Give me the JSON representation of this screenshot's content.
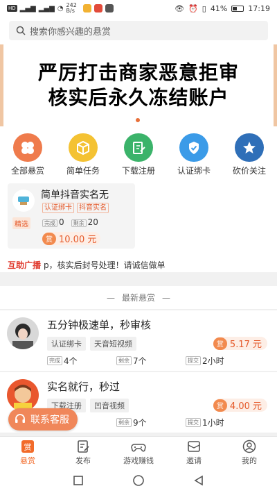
{
  "status_bar": {
    "network": "HD",
    "speed": "242 B/s",
    "battery": "41%",
    "time": "17:19"
  },
  "search": {
    "placeholder": "搜索你感兴趣的悬赏"
  },
  "banner": {
    "line1": "严厉打击商家恶意拒审",
    "line2": "核实后永久冻结账户"
  },
  "categories": [
    {
      "label": "全部悬赏",
      "icon": "clover-icon",
      "color": "#ef7b4c"
    },
    {
      "label": "简单任务",
      "icon": "box-icon",
      "color": "#f4c233"
    },
    {
      "label": "下载注册",
      "icon": "edit-doc-icon",
      "color": "#3bb36a"
    },
    {
      "label": "认证绑卡",
      "icon": "verified-icon",
      "color": "#3b9be8"
    },
    {
      "label": "砍价关注",
      "icon": "star-icon",
      "color": "#2f6fb8"
    }
  ],
  "featured": {
    "badge": "精选",
    "title": "简单抖音实名无",
    "tags": [
      "认证绑卡",
      "抖音实名"
    ],
    "done_label": "完成",
    "done_value": "0",
    "remain_label": "剩余",
    "remain_value": "20",
    "price_icon": "赏",
    "price": "10.00 元"
  },
  "broadcast": {
    "label": "互助广播",
    "text": "p，核实后封号处理！请诚信做单"
  },
  "latest": {
    "title": "最新悬赏"
  },
  "tasks": [
    {
      "title": "五分钟极速单，秒审核",
      "tags": [
        "认证绑卡",
        "天音短视频"
      ],
      "price_icon": "赏",
      "price": "5.17 元",
      "done_label": "完成",
      "done_value": "4个",
      "remain_label": "剩余",
      "remain_value": "7个",
      "submit_label": "提交",
      "submit_value": "2小时"
    },
    {
      "title": "实名就行，秒过",
      "tags": [
        "下载注册",
        "凹音视频"
      ],
      "price_icon": "赏",
      "price": "4.00 元",
      "done_label": "完成",
      "done_value": "",
      "remain_label": "剩余",
      "remain_value": "9个",
      "submit_label": "提交",
      "submit_value": "1小时"
    }
  ],
  "customer_service": {
    "label": "联系客服"
  },
  "tabbar": [
    {
      "label": "悬赏",
      "icon": "bounty-icon",
      "active": true
    },
    {
      "label": "发布",
      "icon": "publish-icon"
    },
    {
      "label": "游戏赚钱",
      "icon": "gamepad-icon"
    },
    {
      "label": "邀请",
      "icon": "invite-icon"
    },
    {
      "label": "我的",
      "icon": "profile-icon"
    }
  ],
  "colors": {
    "accent": "#f26b2a",
    "price": "#e55a2b",
    "broadcast_label": "#e03a2e"
  }
}
